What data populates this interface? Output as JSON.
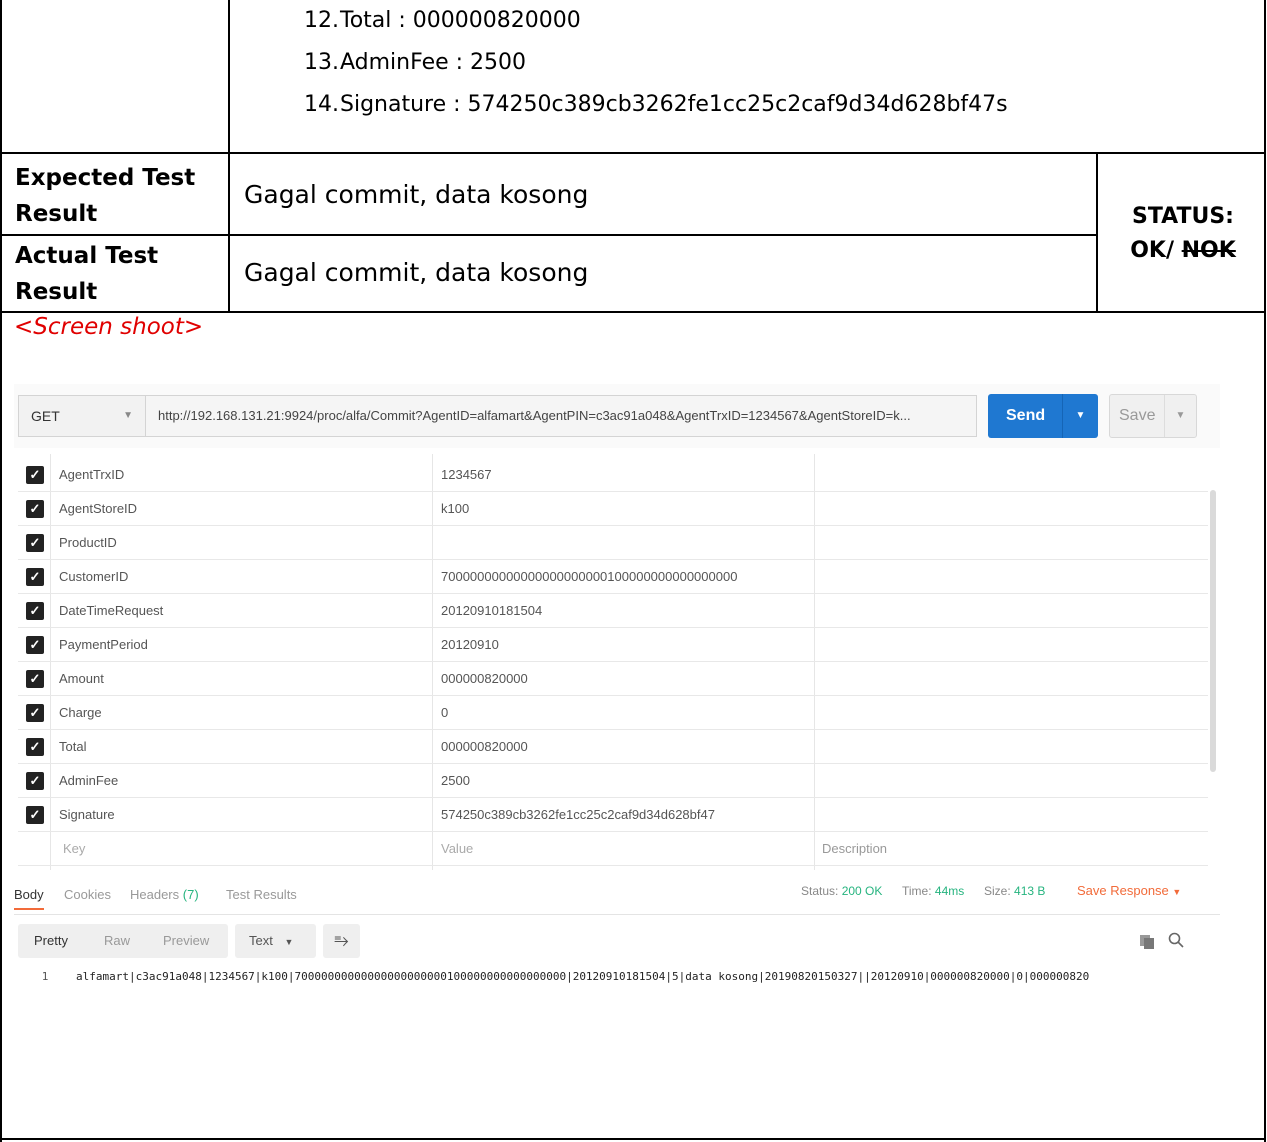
{
  "list_items": [
    {
      "num": "12.",
      "text": "Total : 000000820000"
    },
    {
      "num": "13.",
      "text": "AdminFee : 2500"
    },
    {
      "num": "14.",
      "text": "Signature : 574250c389cb3262fe1cc25c2caf9d34d628bf47s"
    }
  ],
  "expected": {
    "label_line1": "Expected Test",
    "label_line2": "Result",
    "value": "Gagal commit, data kosong"
  },
  "actual": {
    "label_line1": "Actual Test",
    "label_line2": "Result",
    "value": "Gagal commit, data kosong"
  },
  "status": {
    "line1": "STATUS:",
    "ok": "OK/ ",
    "nok": "NOK"
  },
  "caption": "<Screen shoot>",
  "postman": {
    "method": "GET",
    "url": "http://192.168.131.21:9924/proc/alfa/Commit?AgentID=alfamart&AgentPIN=c3ac91a048&AgentTrxID=1234567&AgentStoreID=k...",
    "send_label": "Send",
    "save_label": "Save",
    "params": [
      {
        "key": "AgentTrxID",
        "value": "1234567"
      },
      {
        "key": "AgentStoreID",
        "value": "k100"
      },
      {
        "key": "ProductID",
        "value": ""
      },
      {
        "key": "CustomerID",
        "value": "70000000000000000000000100000000000000000"
      },
      {
        "key": "DateTimeRequest",
        "value": "20120910181504"
      },
      {
        "key": "PaymentPeriod",
        "value": "20120910"
      },
      {
        "key": "Amount",
        "value": "000000820000"
      },
      {
        "key": "Charge",
        "value": "0"
      },
      {
        "key": "Total",
        "value": "000000820000"
      },
      {
        "key": "AdminFee",
        "value": "2500"
      },
      {
        "key": "Signature",
        "value": "574250c389cb3262fe1cc25c2caf9d34d628bf47"
      }
    ],
    "placeholder_row": {
      "key": "Key",
      "value": "Value",
      "description": "Description"
    },
    "response_tabs": {
      "body": "Body",
      "cookies": "Cookies",
      "headers": "Headers",
      "headers_count": "(7)",
      "test_results": "Test Results"
    },
    "status_label": "Status:",
    "status_value": "200 OK",
    "time_label": "Time:",
    "time_value": "44ms",
    "size_label": "Size:",
    "size_value": "413 B",
    "save_response": "Save Response",
    "format_tabs": {
      "pretty": "Pretty",
      "raw": "Raw",
      "preview": "Preview"
    },
    "text_select": "Text",
    "body_line_number": "1",
    "body_line": "alfamart|c3ac91a048|1234567|k100|70000000000000000000000100000000000000000|20120910181504|5|data kosong|20190820150327||20120910|000000820000|0|000000820"
  }
}
